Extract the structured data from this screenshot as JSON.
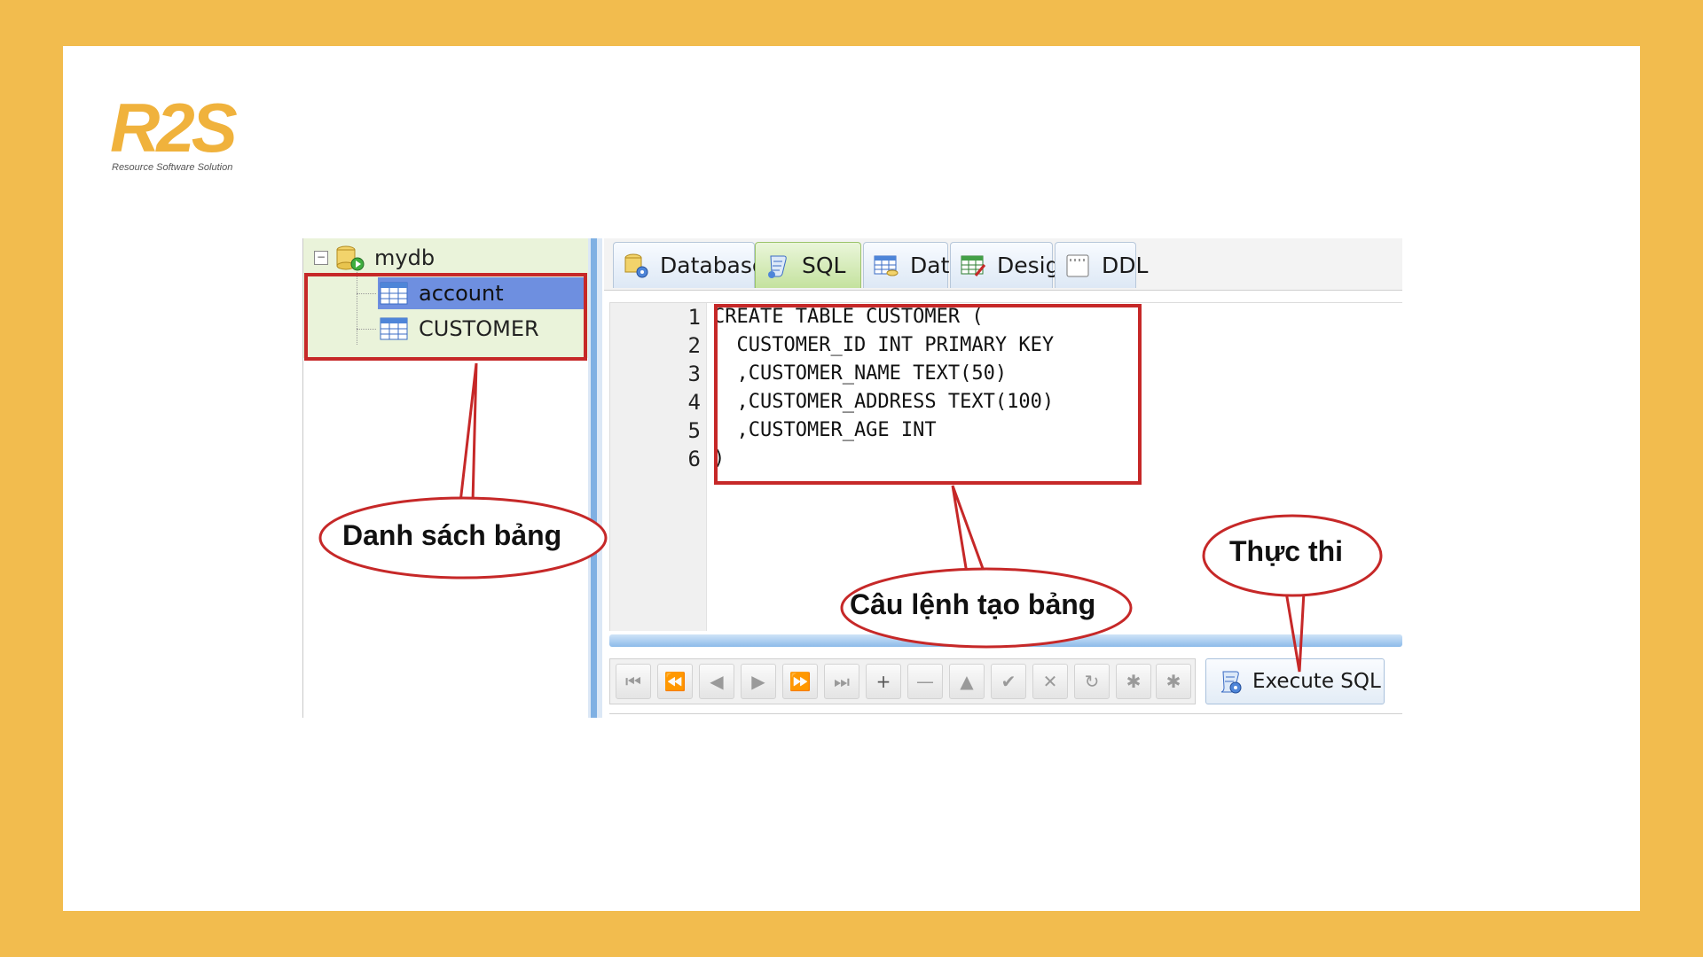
{
  "logo": {
    "mark": "R2S",
    "tagline": "Resource Software Solution"
  },
  "tree": {
    "root_label": "mydb",
    "items": [
      {
        "label": "account",
        "selected": true
      },
      {
        "label": "CUSTOMER",
        "selected": false
      }
    ]
  },
  "tabs": [
    {
      "label": "Database",
      "icon": "database-gear-icon",
      "active": false
    },
    {
      "label": "SQL",
      "icon": "sql-script-icon",
      "active": true
    },
    {
      "label": "Data",
      "icon": "data-grid-icon",
      "active": false
    },
    {
      "label": "Design",
      "icon": "design-grid-icon",
      "active": false
    },
    {
      "label": "DDL",
      "icon": "ddl-document-icon",
      "active": false
    }
  ],
  "editor": {
    "line_numbers": [
      "1",
      "2",
      "3",
      "4",
      "5",
      "6"
    ],
    "lines": [
      "CREATE TABLE CUSTOMER (",
      "  CUSTOMER_ID INT PRIMARY KEY",
      "  ,CUSTOMER_NAME TEXT(50)",
      "  ,CUSTOMER_ADDRESS TEXT(100)",
      "  ,CUSTOMER_AGE INT",
      ")"
    ]
  },
  "toolbar": {
    "buttons": [
      {
        "name": "first-record-button",
        "glyph": "⏮"
      },
      {
        "name": "prev-page-button",
        "glyph": "⏪"
      },
      {
        "name": "prev-record-button",
        "glyph": "◀"
      },
      {
        "name": "next-record-button",
        "glyph": "▶"
      },
      {
        "name": "next-page-button",
        "glyph": "⏩"
      },
      {
        "name": "last-record-button",
        "glyph": "⏭"
      },
      {
        "name": "insert-record-button",
        "glyph": "+"
      },
      {
        "name": "delete-record-button",
        "glyph": "—"
      },
      {
        "name": "edit-record-button",
        "glyph": "▲"
      },
      {
        "name": "post-edit-button",
        "glyph": "✔"
      },
      {
        "name": "cancel-edit-button",
        "glyph": "✕"
      },
      {
        "name": "refresh-button",
        "glyph": "↻"
      },
      {
        "name": "apply-button",
        "glyph": "✱"
      },
      {
        "name": "cancel-updates-button",
        "glyph": "✱"
      }
    ],
    "execute_label": "Execute SQL"
  },
  "annotations": {
    "tables_list": "Danh sách bảng",
    "create_statement": "Câu lệnh tạo bảng",
    "execute": "Thực thi"
  },
  "colors": {
    "background": "#F2BC4E",
    "highlight_box": "#C62828",
    "selection": "#6E8FE0",
    "logo": "#F0B23C"
  }
}
